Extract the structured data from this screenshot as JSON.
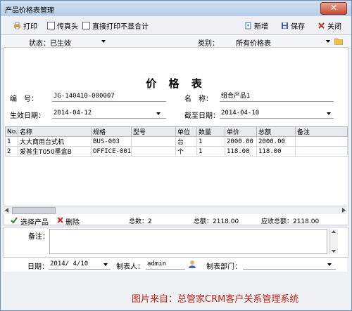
{
  "window": {
    "title": "产品价格表管理",
    "close_label": "✕"
  },
  "toolbar": {
    "print_label": "打印",
    "fax_label": "传真头",
    "direct_print_label": "直接打印不显合计",
    "new_label": "新增",
    "save_label": "保存",
    "close_label": "关闭"
  },
  "filters": {
    "status_label": "状态：",
    "status_value": "已生效",
    "category_label": "类别：",
    "category_value": "所有价格表"
  },
  "doc": {
    "title": "价 格 表",
    "code_label": "编　号：",
    "code_value": "JG-140410-000007",
    "name_label": "名　称：",
    "name_value": "组合产品1",
    "effective_label": "生效日期：",
    "effective_value": "2014-04-12",
    "expiry_label": "截至日期：",
    "expiry_value": "2014-04-10"
  },
  "table": {
    "headers": [
      "No.",
      "名称",
      "规格",
      "型号",
      "单位",
      "数量",
      "单价",
      "总额",
      "备注"
    ],
    "rows": [
      [
        "1",
        "大大商用台式机",
        "BUS-003",
        "",
        "台",
        "1",
        "2000.00",
        "2000.00",
        ""
      ],
      [
        "2",
        "爱普生T050墨盒B",
        "OFFICE-001",
        "",
        "个",
        "1",
        "118.00",
        "118.00",
        ""
      ]
    ]
  },
  "summary": {
    "select_label": "选择产品",
    "delete_label": "删除",
    "count_label": "总数：2",
    "total_label": "总额：2118.00",
    "receivable_label": "应收总额：2118.00"
  },
  "footer": {
    "notes_label": "备注：",
    "date_label": "日期：",
    "date_value": "2014/ 4/10",
    "maker_label": "制表人：",
    "maker_value": "admin",
    "dept_label": "制表部门："
  },
  "credit": "图片来自：总管家CRM客户关系管理系统",
  "colors": {
    "credit": "#c0281e",
    "titlebar": "#b7cfe8",
    "close": "#c84a32"
  }
}
